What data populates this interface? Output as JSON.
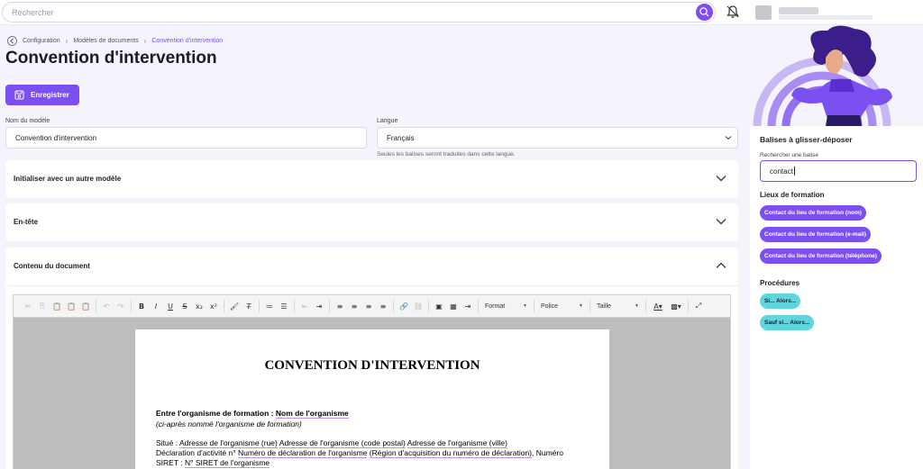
{
  "search": {
    "placeholder": "Rechercher"
  },
  "breadcrumb": {
    "items": [
      "Configuration",
      "Modèles de documents",
      "Convention d'intervention"
    ]
  },
  "page_title": "Convention d'intervention",
  "toolbar": {
    "save_label": "Enregistrer"
  },
  "form": {
    "model_name_label": "Nom du modèle",
    "model_name_value": "Convention d'intervention",
    "language_label": "Langue",
    "language_value": "Français",
    "language_hint": "Seules les balises seront traduites dans cette langue."
  },
  "sections": {
    "init": "Initialiser avec un autre modèle",
    "header": "En-tête",
    "content": "Contenu du document"
  },
  "editor": {
    "format_label": "Format",
    "font_label": "Police",
    "size_label": "Taille"
  },
  "document": {
    "heading": "CONVENTION D'INTERVENTION",
    "org_intro": "Entre l'organisme de formation : ",
    "org_tag": "Nom de l'organisme",
    "org_note": "(ci-après nommé l'organisme de formation)",
    "situe": "Situé : ",
    "addr_street": "Adresse de l'organisme (rue)",
    "addr_postal": "Adresse de l'organisme (code postal)",
    "addr_city": "Adresse de l'organisme (ville)",
    "decl_intro": "Déclaration  d'activité  n°",
    "decl_tag": "Numéro de déclaration de l'organisme",
    "decl_region": "(Région d'acquisition du numéro de déclaration)",
    "decl_numero": ",  Numéro",
    "siret_intro": "SIRET : ",
    "siret_tag": "N° SIRET de l'organisme"
  },
  "sidebar": {
    "title": "Balises à glisser-déposer",
    "search_label": "Rechercher une balise",
    "search_value": "contact",
    "group1_title": "Lieux de formation",
    "group1_chips": [
      "Contact du lieu de formation (nom)",
      "Contact du lieu de formation (e-mail)",
      "Contact du lieu de formation (téléphone)"
    ],
    "group2_title": "Procédures",
    "group2_chips": [
      "Si... Alors...",
      "Sauf si... Alors..."
    ]
  },
  "colors": {
    "accent": "#7b4ff0",
    "chip_teal": "#5fd6dd",
    "background": "#f5f3fc"
  }
}
